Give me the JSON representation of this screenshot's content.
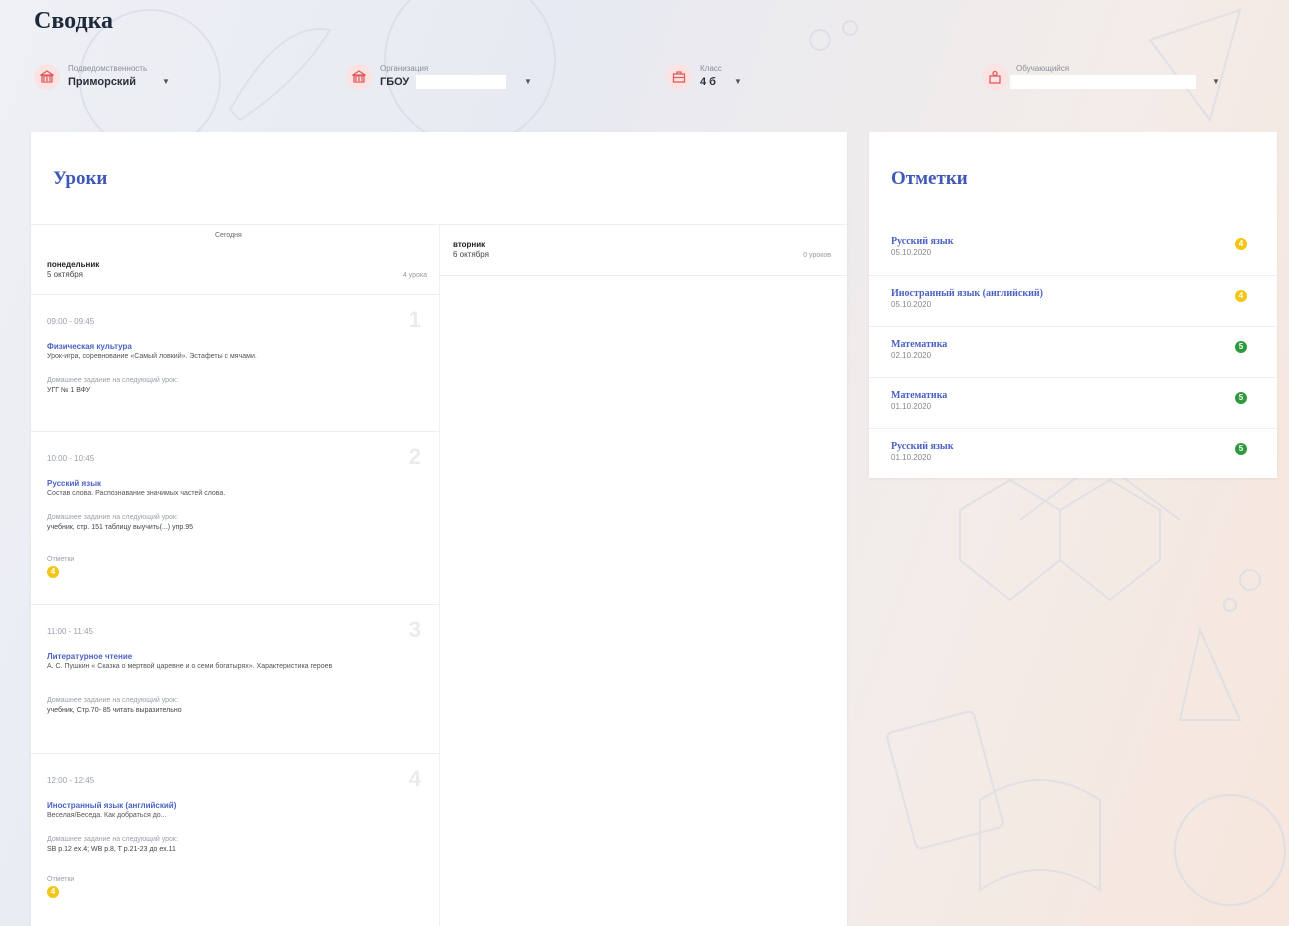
{
  "page": {
    "title": "Сводка"
  },
  "filters": [
    {
      "label": "Подведомственность",
      "value": "Приморский",
      "icon": "building-icon"
    },
    {
      "label": "Организация",
      "value": "ГБОУ",
      "icon": "building-icon"
    },
    {
      "label": "Класс",
      "value": "4 б",
      "icon": "briefcase-icon"
    },
    {
      "label": "Обучающийся",
      "value": "",
      "icon": "person-icon"
    }
  ],
  "lessons": {
    "title": "Уроки",
    "today_label": "Сегодня",
    "days": [
      {
        "name": "понедельник",
        "date": "5 октября",
        "count": "4 урока"
      },
      {
        "name": "вторник",
        "date": "6 октября",
        "count": "0 уроков"
      }
    ],
    "items": [
      {
        "num": "1",
        "time": "09:00 - 09:45",
        "subject": "Физическая культура",
        "topic": "Урок-игра, соревнование «Самый ловкий». Эстафеты с мячами.",
        "hw_label": "Домашнее задание на следующий урок:",
        "hw": "УГГ № 1 ВФУ"
      },
      {
        "num": "2",
        "time": "10:00 - 10:45",
        "subject": "Русский язык",
        "topic": "Состав слова. Распознавание значимых частей слова.",
        "hw_label": "Домашнее задание на следующий урок:",
        "hw": "учебник, стр. 151 таблицу выучить(...) упр.95",
        "marks_label": "Отметки",
        "mark": "4"
      },
      {
        "num": "3",
        "time": "11:00 - 11:45",
        "subject": "Литературное чтение",
        "topic": "А. С. Пушкин « Сказка о мертвой царевне и о семи богатырях». Характеристика героев",
        "hw_label": "Домашнее задание на следующий урок:",
        "hw": "учебник, Стр.70- 85 читать выразительно"
      },
      {
        "num": "4",
        "time": "12:00 - 12:45",
        "subject": "Иностранный язык (английский)",
        "topic": "Веселая/Беседа. Как добраться до...",
        "hw_label": "Домашнее задание на следующий урок:",
        "hw": "SB p.12 ex.4; WB p.8, T p.21-23 до ех.11",
        "marks_label": "Отметки",
        "mark": "4"
      }
    ]
  },
  "marks": {
    "title": "Отметки",
    "items": [
      {
        "subject": "Русский язык",
        "date": "05.10.2020",
        "mark": "4",
        "color": "#f2c614"
      },
      {
        "subject": "Иностранный язык (английский)",
        "date": "05.10.2020",
        "mark": "4",
        "color": "#f2c614"
      },
      {
        "subject": "Математика",
        "date": "02.10.2020",
        "mark": "5",
        "color": "#2f9a3b"
      },
      {
        "subject": "Математика",
        "date": "01.10.2020",
        "mark": "5",
        "color": "#2f9a3b"
      },
      {
        "subject": "Русский язык",
        "date": "01.10.2020",
        "mark": "5",
        "color": "#2f9a3b"
      }
    ]
  },
  "colors": {
    "accent": "#4b62c4",
    "mark_4": "#f2c614",
    "mark_5": "#2f9a3b",
    "icon_bg": "#fbe3e3"
  }
}
